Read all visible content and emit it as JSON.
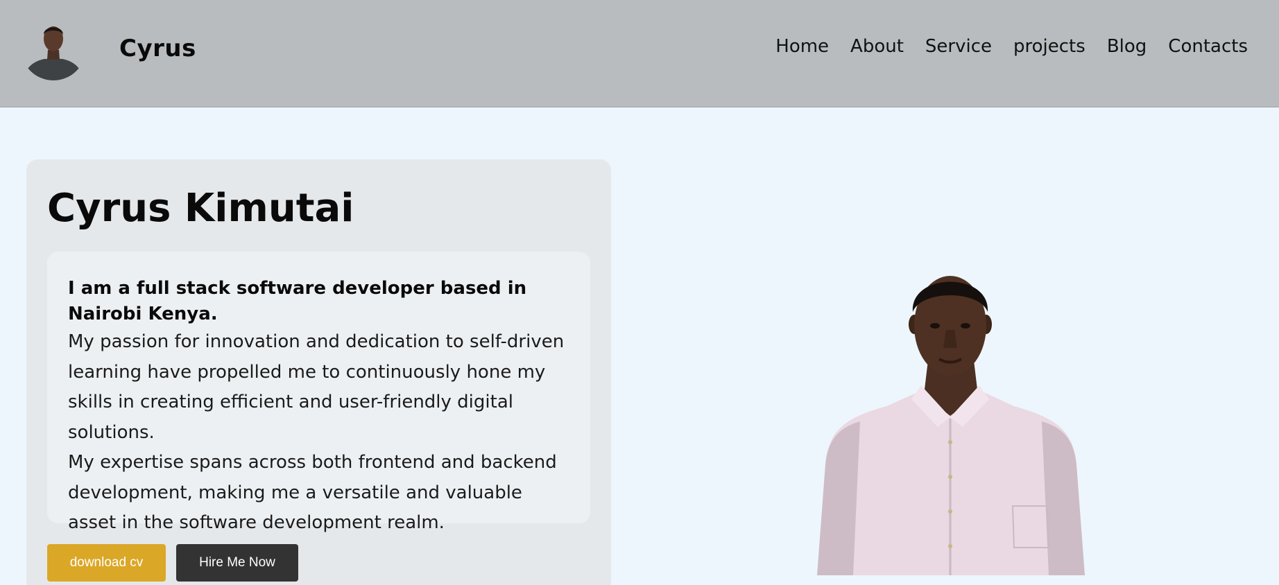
{
  "header": {
    "brand": "Cyrus",
    "nav": [
      "Home",
      "About",
      "Service",
      "projects",
      "Blog",
      "Contacts"
    ]
  },
  "intro": {
    "name": "Cyrus Kimutai",
    "lead": "I am a full stack software developer based in Nairobi Kenya.",
    "paragraphs": [
      "My passion for innovation and dedication to self-driven learning have propelled me to continuously hone my skills in creating efficient and user-friendly digital solutions.",
      "My expertise spans across both frontend and backend development, making me a versatile and valuable asset in the software development realm."
    ],
    "buttons": {
      "download": "download cv",
      "hire": "Hire Me Now"
    }
  },
  "colors": {
    "header_bg": "#b8bcbf",
    "page_bg": "#eef6fd",
    "card_bg": "#e5e8eb",
    "download_button": "#dba727",
    "hire_button": "#333333"
  }
}
